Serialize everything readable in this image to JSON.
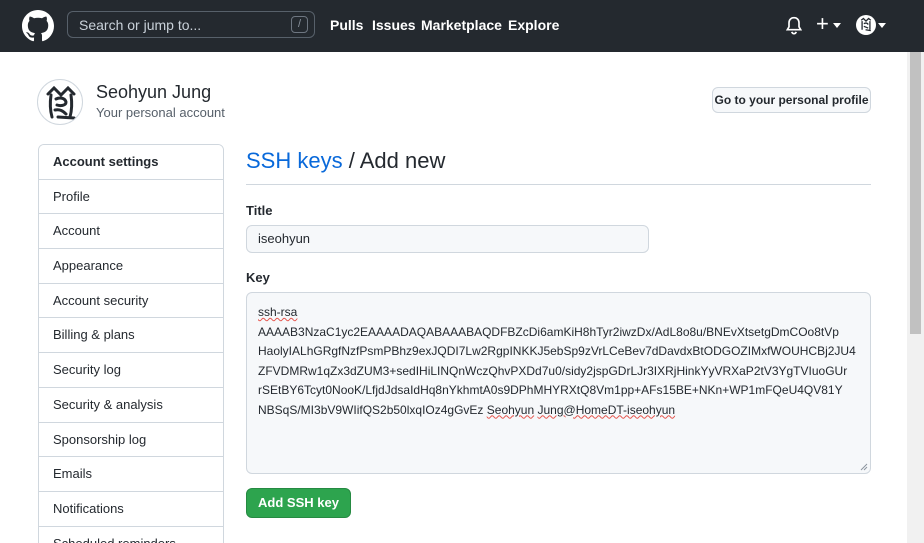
{
  "header": {
    "search_placeholder": "Search or jump to...",
    "search_shortcut": "/",
    "nav": [
      "Pulls",
      "Issues",
      "Marketplace",
      "Explore"
    ],
    "plus_symbol": "+"
  },
  "user": {
    "name": "Seohyun Jung",
    "subtitle": "Your personal account",
    "profile_button": "Go to your personal profile"
  },
  "sidebar": {
    "items": [
      {
        "label": "Account settings"
      },
      {
        "label": "Profile"
      },
      {
        "label": "Account"
      },
      {
        "label": "Appearance"
      },
      {
        "label": "Account security"
      },
      {
        "label": "Billing & plans"
      },
      {
        "label": "Security log"
      },
      {
        "label": "Security & analysis"
      },
      {
        "label": "Sponsorship log"
      },
      {
        "label": "Emails"
      },
      {
        "label": "Notifications"
      },
      {
        "label": "Scheduled reminders"
      }
    ]
  },
  "main": {
    "heading_link": "SSH keys",
    "heading_sep": "/",
    "heading_rest": "Add new",
    "title_label": "Title",
    "title_value": "iseohyun",
    "key_label": "Key",
    "key_lines": [
      "ssh-rsa",
      "AAAAB3NzaC1yc2EAAAADAQABAAABAQDFBZcDi6amKiH8hTyr2iwzDx/AdL8o8u/BNEvXtsetgDmCOo8tVp",
      "HaolyIALhGRgfNzfPsmPBhz9exJQDI7Lw2RgpINKKJ5ebSp9zVrLCeBev7dDavdxBtODGOZIMxfWOUHCBj2JU4",
      "ZFVDMRw1qZx3dZUM3+sedIHiLINQnWczQhvPXDd7u0/sidy2jspGDrLJr3IXRjHinkYyVRXaP2tV3YgTVIuoGUr",
      "rSEtBY6Tcyt0NooK/LfjdJdsaIdHq8nYkhmtA0s9DPhMHYRXtQ8Vm1pp+AFs15BE+NKn+WP1mFQeU4QV81Y",
      "NBSqS/MI3bV9WIifQS2b50lxqIOz4gGvEz "
    ],
    "key_last_name1": "Seohyun",
    "key_last_space": " ",
    "key_last_name2": "Jung@HomeDT-iseohyun",
    "submit_button": "Add SSH key"
  },
  "colors": {
    "header_bg": "#24292f",
    "link_blue": "#0969da",
    "primary_green": "#2da44e"
  }
}
